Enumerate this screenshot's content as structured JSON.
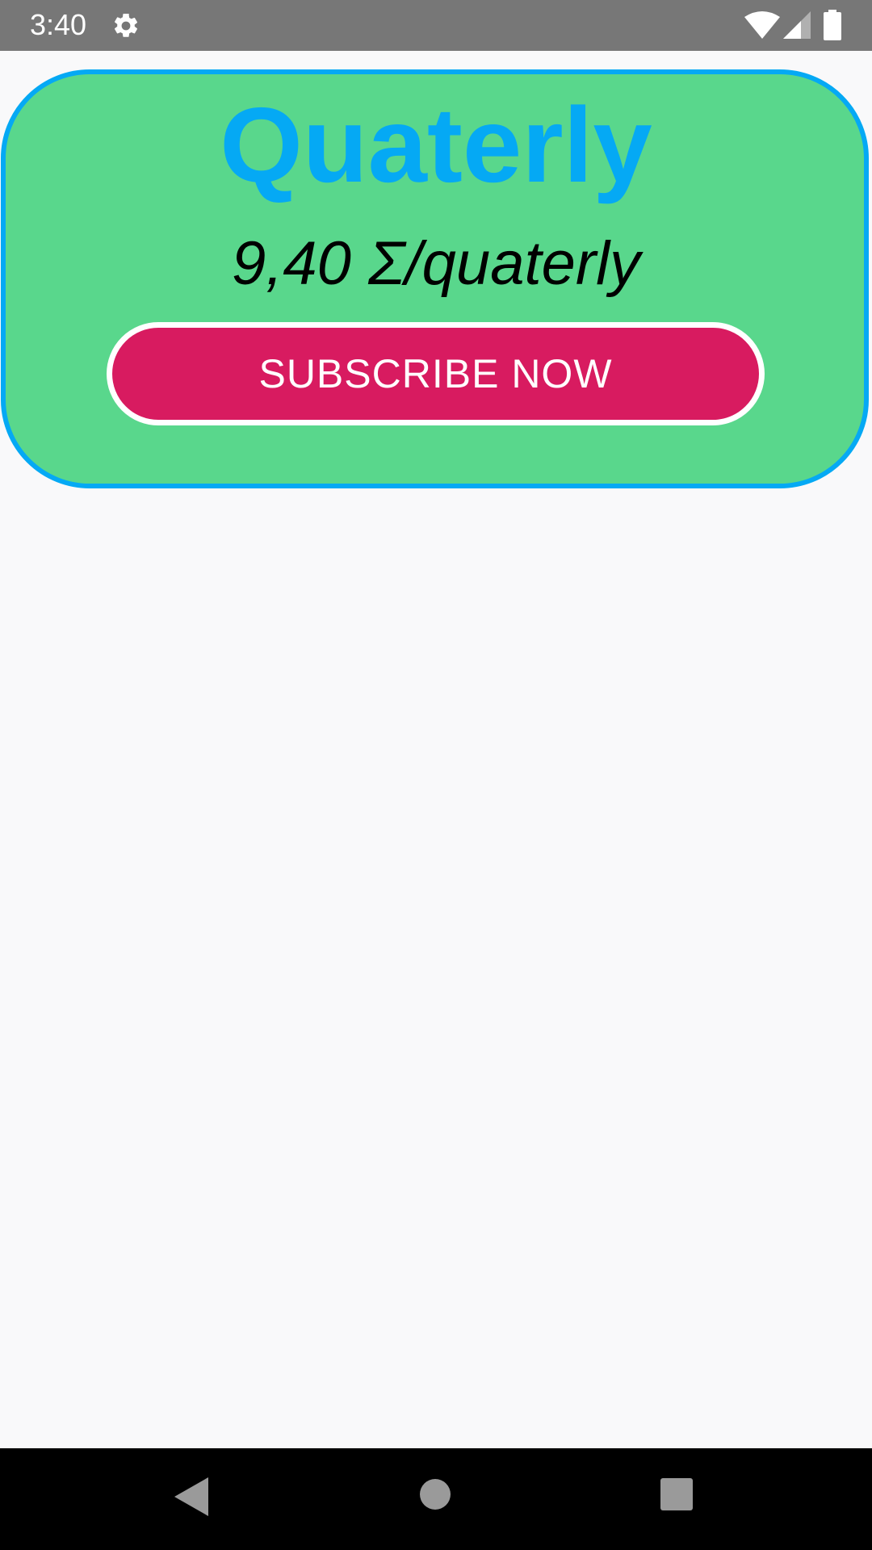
{
  "status_bar": {
    "time": "3:40",
    "icons": [
      "gear-icon",
      "wifi-icon",
      "signal-icon",
      "battery-icon"
    ]
  },
  "plan": {
    "title": "Quaterly",
    "price": "9,40 Σ/quaterly",
    "button_label": "SUBSCRIBE NOW"
  },
  "nav_bar": {
    "icons": [
      "back-icon",
      "home-icon",
      "recents-icon"
    ]
  },
  "colors": {
    "status_bar_bg": "#777777",
    "page_bg": "#f9f9fa",
    "card_bg": "#59d78c",
    "card_border": "#05a9f4",
    "title_text": "#05a9f4",
    "button_bg": "#d81b60",
    "button_border": "#ffffff",
    "nav_bar_bg": "#000000"
  }
}
